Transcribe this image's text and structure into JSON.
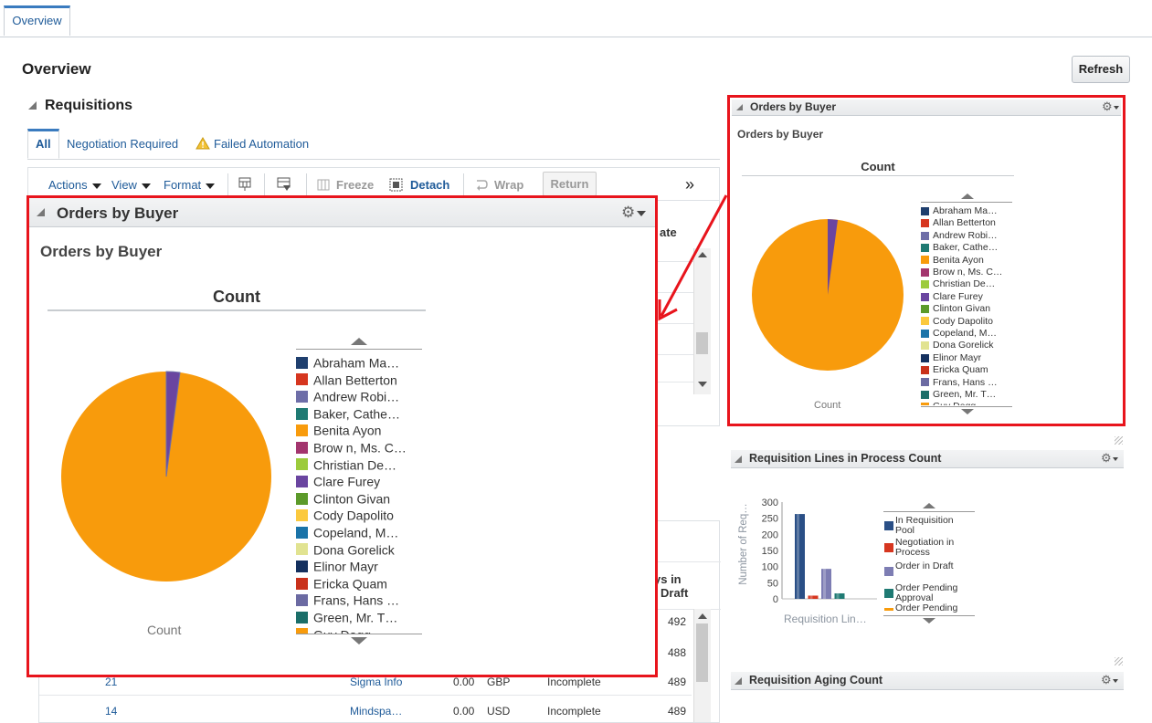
{
  "top_tab": "Overview",
  "page_title": "Overview",
  "refresh_label": "Refresh",
  "requisitions": {
    "title": "Requisitions",
    "tabs": [
      "All",
      "Negotiation Required",
      "Failed Automation"
    ],
    "toolbar": {
      "actions": "Actions",
      "view": "View",
      "format": "Format",
      "freeze": "Freeze",
      "detach": "Detach",
      "wrap": "Wrap",
      "return": "Return",
      "more": "»"
    },
    "partial_header": "ate"
  },
  "lower_table": {
    "header_days_in": "ys in",
    "header_draft": "Draft",
    "rows": [
      {
        "num": "",
        "supplier": "",
        "amount": "",
        "currency": "",
        "status": "",
        "days": "492"
      },
      {
        "num": "",
        "supplier": "",
        "amount": "",
        "currency": "",
        "status": "",
        "days": "488"
      },
      {
        "num": "21",
        "supplier": "Sigma Info",
        "amount": "0.00",
        "currency": "GBP",
        "status": "Incomplete",
        "days": "489"
      },
      {
        "num": "14",
        "supplier": "Mindspa…",
        "amount": "0.00",
        "currency": "USD",
        "status": "Incomplete",
        "days": "489"
      }
    ]
  },
  "orders_by_buyer": {
    "panel_title": "Orders by Buyer",
    "chart_title": "Orders by Buyer",
    "measure": "Count",
    "footer_label": "Count",
    "legend": [
      {
        "label": "Abraham Ma…",
        "color": "#1f3f6e"
      },
      {
        "label": "Allan Betterton",
        "color": "#d6361f"
      },
      {
        "label": "Andrew Robi…",
        "color": "#6e6ea8"
      },
      {
        "label": "Baker, Cathe…",
        "color": "#1f7a73"
      },
      {
        "label": "Benita Ayon",
        "color": "#f89b0c"
      },
      {
        "label": "Brow n, Ms. C…",
        "color": "#a3356e"
      },
      {
        "label": "Christian De…",
        "color": "#9ccb3c"
      },
      {
        "label": "Clare Furey",
        "color": "#6a45a0"
      },
      {
        "label": "Clinton Givan",
        "color": "#5c9a2a"
      },
      {
        "label": "Cody Dapolito",
        "color": "#fbc93e"
      },
      {
        "label": "Copeland, M…",
        "color": "#1a73a8"
      },
      {
        "label": "Dona Gorelick",
        "color": "#e1e391"
      },
      {
        "label": "Elinor Mayr",
        "color": "#14305e"
      },
      {
        "label": "Ericka Quam",
        "color": "#c9311b"
      },
      {
        "label": "Frans, Hans …",
        "color": "#6b6aa2"
      },
      {
        "label": "Green, Mr. T…",
        "color": "#1b6e69"
      },
      {
        "label": "Guy Dagg",
        "color": "#f89b0c"
      }
    ]
  },
  "req_lines": {
    "panel_title": "Requisition Lines in Process Count",
    "ylabel": "Number of Req…",
    "xlabel": "Requisition Lin…",
    "yticks": [
      "300",
      "250",
      "200",
      "150",
      "100",
      "50",
      "0"
    ],
    "legend": [
      {
        "label": "In Requisition Pool",
        "color": "#2a4f86"
      },
      {
        "label": "Negotiation in Process",
        "color": "#d6361f"
      },
      {
        "label": "Order in Draft",
        "color": "#7d7db3"
      },
      {
        "label": "Order Pending Approval",
        "color": "#1f7a73"
      },
      {
        "label": "Order Pending",
        "color": "#f89b0c"
      }
    ]
  },
  "chart_data": {
    "type": "bar",
    "categories": [
      "Requisition Lin…"
    ],
    "series": [
      {
        "name": "In Requisition Pool",
        "values": [
          263
        ]
      },
      {
        "name": "Negotiation in Process",
        "values": [
          10
        ]
      },
      {
        "name": "Order in Draft",
        "values": [
          93
        ]
      },
      {
        "name": "Order Pending Approval",
        "values": [
          17
        ]
      }
    ],
    "xlabel": "Requisition Lin…",
    "ylabel": "Number of Req…",
    "ylim": [
      0,
      300
    ]
  },
  "req_aging": {
    "panel_title": "Requisition Aging Count"
  }
}
